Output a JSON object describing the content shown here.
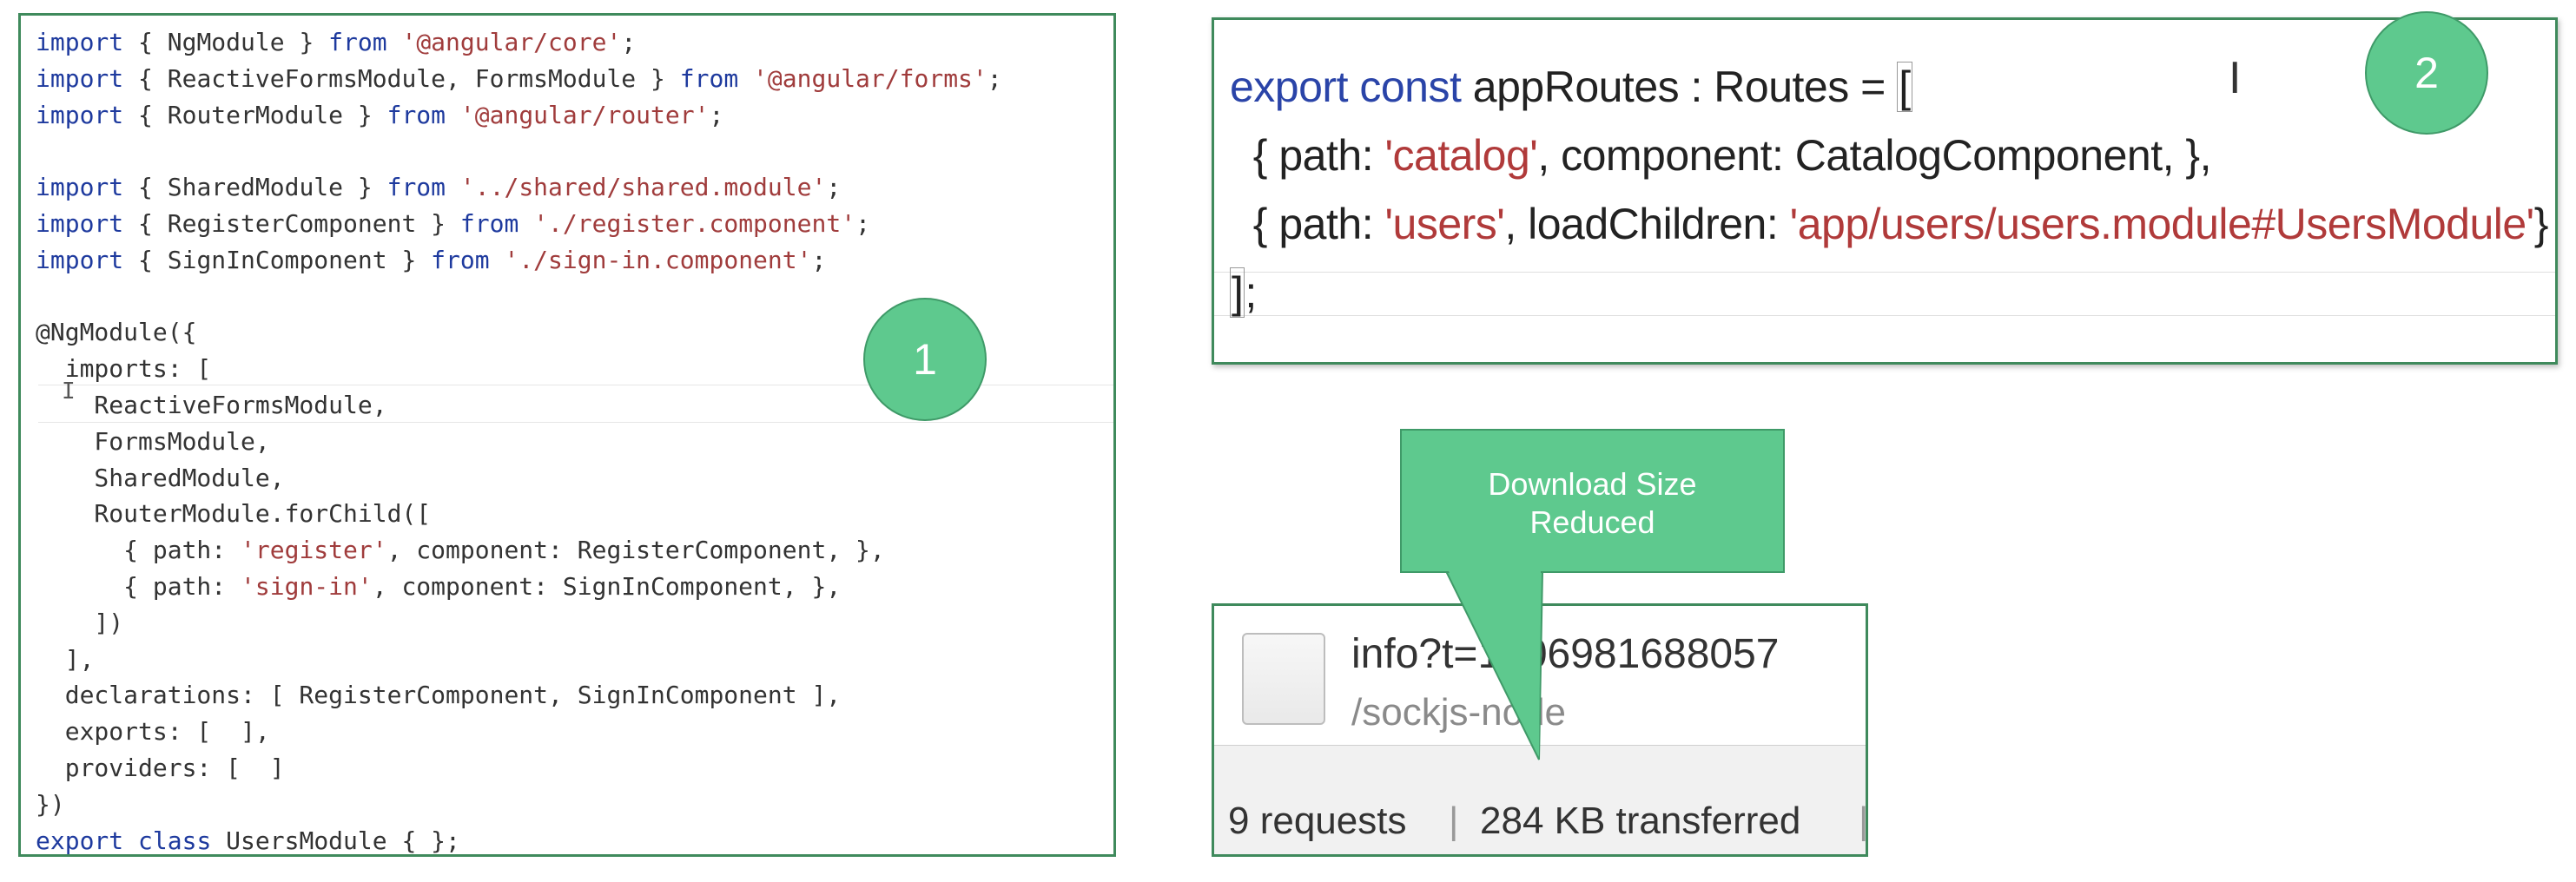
{
  "panel1": {
    "lines": [
      [
        {
          "t": "import",
          "c": "kw"
        },
        {
          "t": " { NgModule } "
        },
        {
          "t": "from",
          "c": "kw"
        },
        {
          "t": " "
        },
        {
          "t": "'@angular/core'",
          "c": "str"
        },
        {
          "t": ";"
        }
      ],
      [
        {
          "t": "import",
          "c": "kw"
        },
        {
          "t": " { ReactiveFormsModule, FormsModule } "
        },
        {
          "t": "from",
          "c": "kw"
        },
        {
          "t": " "
        },
        {
          "t": "'@angular/forms'",
          "c": "str"
        },
        {
          "t": ";"
        }
      ],
      [
        {
          "t": "import",
          "c": "kw"
        },
        {
          "t": " { RouterModule } "
        },
        {
          "t": "from",
          "c": "kw"
        },
        {
          "t": " "
        },
        {
          "t": "'@angular/router'",
          "c": "str"
        },
        {
          "t": ";"
        }
      ],
      [
        {
          "t": ""
        }
      ],
      [
        {
          "t": "import",
          "c": "kw"
        },
        {
          "t": " { SharedModule } "
        },
        {
          "t": "from",
          "c": "kw"
        },
        {
          "t": " "
        },
        {
          "t": "'../shared/shared.module'",
          "c": "str"
        },
        {
          "t": ";"
        }
      ],
      [
        {
          "t": "import",
          "c": "kw"
        },
        {
          "t": " { RegisterComponent } "
        },
        {
          "t": "from",
          "c": "kw"
        },
        {
          "t": " "
        },
        {
          "t": "'./register.component'",
          "c": "str"
        },
        {
          "t": ";"
        }
      ],
      [
        {
          "t": "import",
          "c": "kw"
        },
        {
          "t": " { SignInComponent } "
        },
        {
          "t": "from",
          "c": "kw"
        },
        {
          "t": " "
        },
        {
          "t": "'./sign-in.component'",
          "c": "str"
        },
        {
          "t": ";"
        }
      ],
      [
        {
          "t": ""
        }
      ],
      [
        {
          "t": "@NgModule({"
        }
      ],
      [
        {
          "t": "  imports: ["
        }
      ],
      [
        {
          "t": "    ReactiveFormsModule,"
        }
      ],
      [
        {
          "t": "    FormsModule,"
        }
      ],
      [
        {
          "t": "    SharedModule,"
        }
      ],
      [
        {
          "t": "    RouterModule.forChild(["
        }
      ],
      [
        {
          "t": "      { path: "
        },
        {
          "t": "'register'",
          "c": "str"
        },
        {
          "t": ", component: RegisterComponent, },"
        }
      ],
      [
        {
          "t": "      { path: "
        },
        {
          "t": "'sign-in'",
          "c": "str"
        },
        {
          "t": ", component: SignInComponent, },"
        }
      ],
      [
        {
          "t": "    ])"
        }
      ],
      [
        {
          "t": "  ],"
        }
      ],
      [
        {
          "t": "  declarations: [ RegisterComponent, SignInComponent ],"
        }
      ],
      [
        {
          "t": "  exports: [  ],"
        }
      ],
      [
        {
          "t": "  providers: [  ]"
        }
      ],
      [
        {
          "t": "})"
        }
      ],
      [
        {
          "t": "export",
          "c": "kw"
        },
        {
          "t": " "
        },
        {
          "t": "class",
          "c": "kw"
        },
        {
          "t": " UsersModule { };"
        }
      ]
    ],
    "badge": "1"
  },
  "panel2": {
    "lines": [
      [
        {
          "t": "export",
          "c": "kw"
        },
        {
          "t": " "
        },
        {
          "t": "const",
          "c": "kw"
        },
        {
          "t": " appRoutes : Routes = "
        },
        {
          "t": "[",
          "c": "box"
        }
      ],
      [
        {
          "t": "  { path: "
        },
        {
          "t": "'catalog'",
          "c": "str"
        },
        {
          "t": ", component: CatalogComponent, },"
        }
      ],
      [
        {
          "t": "  { path: "
        },
        {
          "t": "'users'",
          "c": "str"
        },
        {
          "t": ", loadChildren: "
        },
        {
          "t": "'app/users/users.module#UsersModule'",
          "c": "str"
        },
        {
          "t": "}"
        }
      ],
      [
        {
          "t": "]",
          "c": "box"
        },
        {
          "t": ";"
        }
      ]
    ],
    "badge": "2"
  },
  "callout": {
    "line1": "Download Size",
    "line2": "Reduced"
  },
  "devtools": {
    "request_name": "info?t=1506981688057",
    "request_path": "/sockjs-node",
    "requests": "9 requests",
    "transferred": "284 KB transferred"
  },
  "colors": {
    "accent_green": "#5ec98e",
    "border_green": "#3f8a5c",
    "keyword": "#1e3a9e",
    "string": "#a03c3c"
  }
}
